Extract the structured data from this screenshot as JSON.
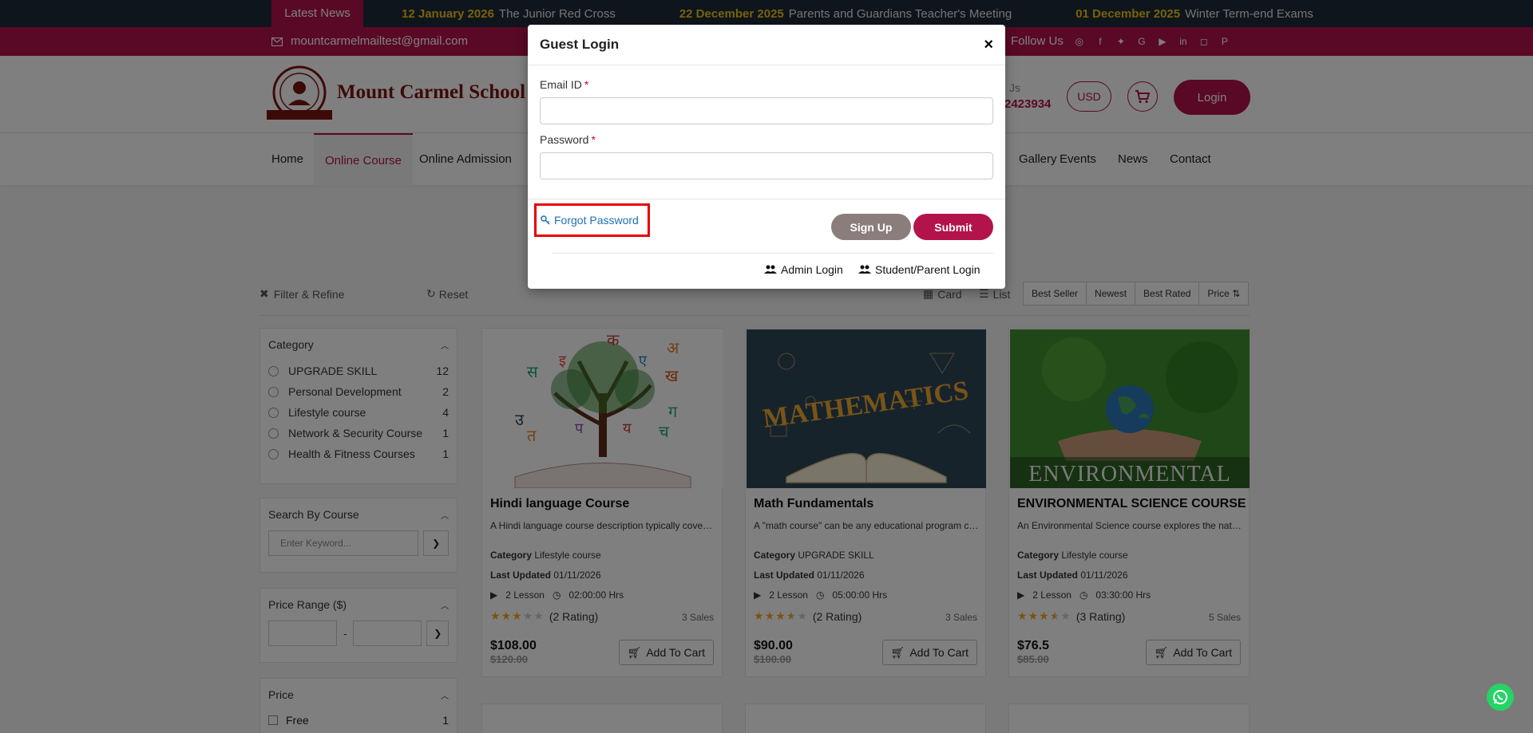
{
  "ticker": {
    "label": "Latest News",
    "items": [
      {
        "date": "12 January 2026",
        "text": "The Junior Red Cross"
      },
      {
        "date": "22 December 2025",
        "text": "Parents and Guardians Teacher's Meeting"
      },
      {
        "date": "01 December 2025",
        "text": "Winter Term-end Exams"
      }
    ]
  },
  "topbar": {
    "email": "mountcarmelmailtest@gmail.com",
    "follow_label": "Follow Us",
    "social_icons": [
      "whatsapp-icon",
      "facebook-icon",
      "twitter-icon",
      "google-plus-icon",
      "youtube-icon",
      "linkedin-icon",
      "instagram-icon",
      "pinterest-icon"
    ]
  },
  "header": {
    "brand": "Mount Carmel School",
    "phone_fragment": "Js",
    "phone": "2423934",
    "currency": "USD",
    "login_label": "Login"
  },
  "nav": {
    "items": [
      "Home",
      "Online Course",
      "Online Admission",
      "Gallery",
      "Events",
      "News",
      "Contact"
    ],
    "active": "Online Course"
  },
  "toolbar": {
    "filter_label": "Filter & Refine",
    "reset_label": "Reset",
    "card_label": "Card",
    "list_label": "List",
    "sort": [
      "Best Seller",
      "Newest",
      "Best Rated",
      "Price"
    ]
  },
  "sidebar": {
    "category": {
      "title": "Category",
      "items": [
        {
          "label": "UPGRADE SKILL",
          "count": "12"
        },
        {
          "label": "Personal Development",
          "count": "2"
        },
        {
          "label": "Lifestyle course",
          "count": "4"
        },
        {
          "label": "Network & Security Course",
          "count": "1"
        },
        {
          "label": "Health & Fitness Courses",
          "count": "1"
        }
      ]
    },
    "search": {
      "title": "Search By Course",
      "placeholder": "Enter Keyword..."
    },
    "price_range": {
      "title": "Price Range ($)",
      "separator": "-"
    },
    "price": {
      "title": "Price",
      "items": [
        {
          "label": "Free",
          "count": "1"
        }
      ]
    }
  },
  "courses": [
    {
      "title": "Hindi language Course",
      "desc": "A Hindi language course description typically covers the basics of the language",
      "category_label": "Category",
      "category": "Lifestyle course",
      "updated_label": "Last Updated",
      "updated": "01/11/2026",
      "lessons": "2 Lesson",
      "duration": "02:00:00 Hrs",
      "stars": 3,
      "rating": "(2 Rating)",
      "sales": "3 Sales",
      "price": "$108.00",
      "old_price": "$120.00",
      "cart_label": "Add To Cart"
    },
    {
      "title": "Math Fundamentals",
      "desc": "A \"math course\" can be any educational program covering mathematics",
      "category_label": "Category",
      "category": "UPGRADE SKILL",
      "updated_label": "Last Updated",
      "updated": "01/11/2026",
      "lessons": "2 Lesson",
      "duration": "05:00:00 Hrs",
      "stars": 3.5,
      "rating": "(2 Rating)",
      "sales": "3 Sales",
      "price": "$90.00",
      "old_price": "$100.00",
      "cart_label": "Add To Cart"
    },
    {
      "title": "ENVIRONMENTAL SCIENCE COURSE",
      "desc": "An Environmental Science course explores the natural world",
      "category_label": "Category",
      "category": "Lifestyle course",
      "updated_label": "Last Updated",
      "updated": "01/11/2026",
      "lessons": "2 Lesson",
      "duration": "03:30:00 Hrs",
      "stars": 3.5,
      "rating": "(3 Rating)",
      "sales": "5 Sales",
      "price": "$76.5",
      "old_price": "$85.00",
      "cart_label": "Add To Cart"
    }
  ],
  "course_images": {
    "math_word": "MATHEMATICS",
    "env_word": "ENVIRONMENTAL",
    "hindi_letters": [
      "क",
      "अ",
      "स",
      "ख",
      "उ",
      "प",
      "ग",
      "च",
      "त",
      "य",
      "इ",
      "ए"
    ]
  },
  "modal": {
    "title": "Guest Login",
    "close": "×",
    "email_label": "Email ID",
    "password_label": "Password",
    "required_mark": "*",
    "forgot_label": "Forgot Password",
    "signup_label": "Sign Up",
    "submit_label": "Submit",
    "admin_login_label": "Admin Login",
    "student_login_label": "Student/Parent Login"
  },
  "colors": {
    "brand": "#b3134a",
    "ticker_bg": "#1e2a3a",
    "ticker_date": "#f1c40f",
    "link": "#1f6fb5",
    "highlight": "#e60000"
  }
}
